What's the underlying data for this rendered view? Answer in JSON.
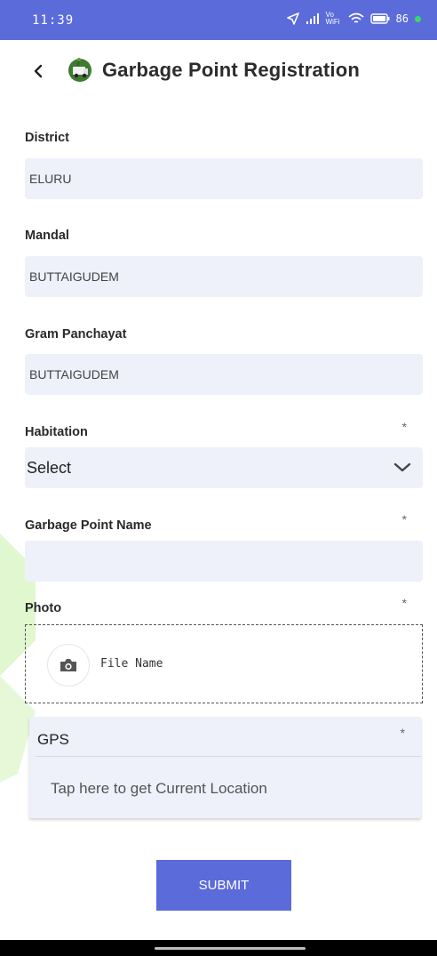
{
  "status_bar": {
    "time": "11:39",
    "signal_text": "Vo WiFi",
    "battery": "86"
  },
  "header": {
    "title": "Garbage Point Registration"
  },
  "form": {
    "district": {
      "label": "District",
      "value": "ELURU"
    },
    "mandal": {
      "label": "Mandal",
      "value": "BUTTAIGUDEM"
    },
    "gram_panchayat": {
      "label": "Gram Panchayat",
      "value": "BUTTAIGUDEM"
    },
    "habitation": {
      "label": "Habitation",
      "value": "Select",
      "required": "*"
    },
    "garbage_point_name": {
      "label": "Garbage Point Name",
      "value": "",
      "required": "*"
    },
    "photo": {
      "label": "Photo",
      "file_name": "File Name",
      "required": "*"
    },
    "gps": {
      "label": "GPS",
      "action": "Tap here to get Current Location",
      "required": "*"
    },
    "submit_label": "SUBMIT"
  },
  "colors": {
    "primary": "#5b6bda",
    "field_bg": "#eef0fa",
    "watermark": "#c8f0a8"
  }
}
